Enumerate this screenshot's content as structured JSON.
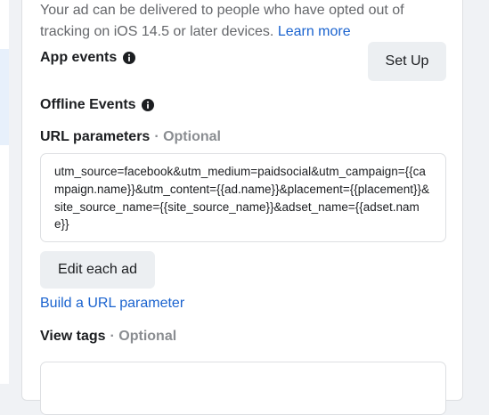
{
  "intro": {
    "text": "Your ad can be delivered to people who have opted out of tracking on iOS 14.5 or later devices.",
    "learn_more_label": "Learn more"
  },
  "app_events": {
    "label": "App events",
    "button_label": "Set Up",
    "info_icon": "info-icon"
  },
  "offline_events": {
    "label": "Offline Events",
    "info_icon": "info-icon"
  },
  "url_parameters": {
    "label": "URL parameters",
    "optional_label": "· Optional",
    "value": "utm_source=facebook&utm_medium=paidsocial&utm_campaign={{campaign.name}}&utm_content={{ad.name}}&placement={{placement}}&site_source_name={{site_source_name}}&adset_name={{adset.name}}",
    "edit_button_label": "Edit each ad",
    "build_link_label": "Build a URL parameter"
  },
  "view_tags": {
    "label": "View tags",
    "optional_label": "· Optional",
    "value": ""
  },
  "colors": {
    "link": "#1a63cf",
    "text": "#1c1e21",
    "muted": "#65676b",
    "button_bg": "#eceff2",
    "border": "#dddfe2"
  }
}
